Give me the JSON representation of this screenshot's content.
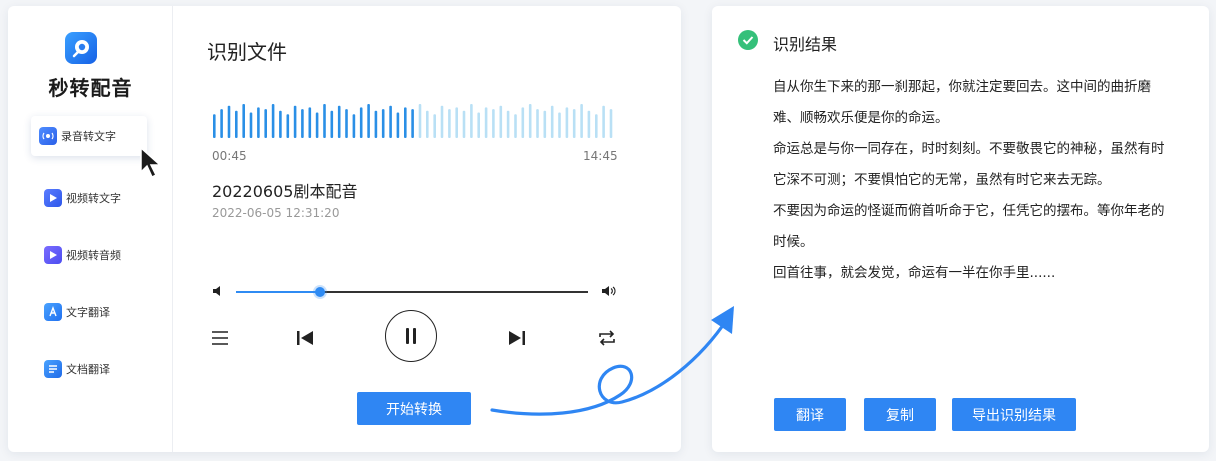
{
  "sidebar": {
    "app_title": "秒转配音",
    "items": [
      {
        "label": "录音转文字",
        "icon": "recording-icon",
        "active": true
      },
      {
        "label": "视频转文字",
        "icon": "video-icon",
        "active": false
      },
      {
        "label": "视频转音频",
        "icon": "video-audio-icon",
        "active": false
      },
      {
        "label": "文字翻译",
        "icon": "translate-icon",
        "active": false
      },
      {
        "label": "文档翻译",
        "icon": "document-icon",
        "active": false
      }
    ]
  },
  "main": {
    "title": "识别文件",
    "time_start": "00:45",
    "time_end": "14:45",
    "file_name": "20220605剧本配音",
    "file_date": "2022-06-05   12:31:20",
    "playback_progress": 0.24,
    "start_button_label": "开始转换"
  },
  "result": {
    "title": "识别结果",
    "lines": [
      "自从你生下来的那一刹那起，你就注定要回去。这中间的曲折磨",
      "难、顺畅欢乐便是你的命运。",
      "命运总是与你一同存在，时时刻刻。不要敬畏它的神秘，虽然有时",
      "它深不可测；不要惧怕它的无常，虽然有时它来去无踪。",
      "不要因为命运的怪诞而俯首听命于它，任凭它的摆布。等你年老的",
      "时候。",
      "回首往事，就会发觉，命运有一半在你手里......"
    ],
    "buttons": {
      "translate": "翻译",
      "copy": "复制",
      "export": "导出识别结果"
    }
  },
  "colors": {
    "accent": "#2f86f3",
    "wave_played": "#2a8fe6",
    "wave_unplayed": "#b9e0f5",
    "success": "#35c07a"
  }
}
